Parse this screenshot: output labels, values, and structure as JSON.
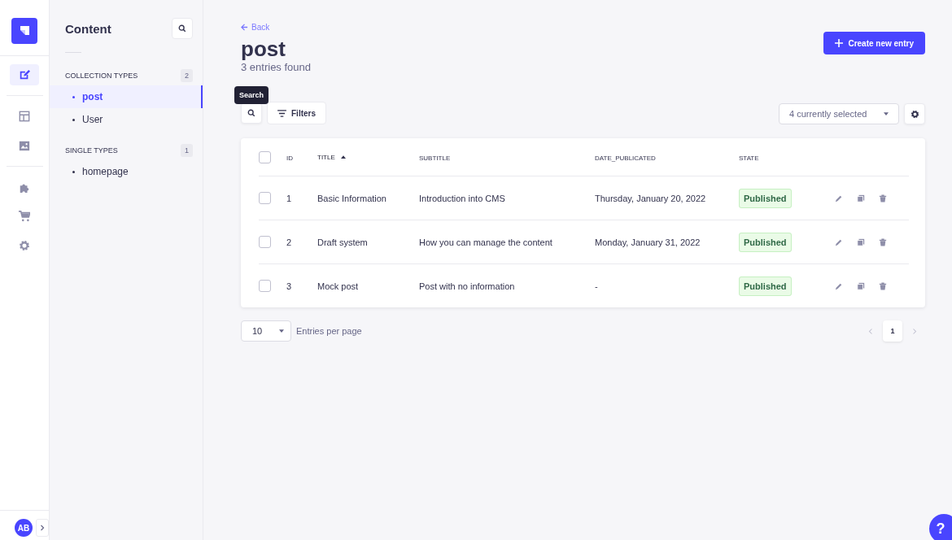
{
  "nav": {
    "items": [
      {
        "selected": true
      },
      {
        "selected": false
      },
      {
        "selected": false
      },
      {
        "selected": false
      },
      {
        "selected": false
      },
      {
        "selected": false
      }
    ],
    "avatar": "AB"
  },
  "sidebar": {
    "title": "Content",
    "sections": [
      {
        "heading": "COLLECTION TYPES",
        "count": "2",
        "items": [
          {
            "label": "post",
            "selected": true
          },
          {
            "label": "User",
            "selected": false
          }
        ]
      },
      {
        "heading": "SINGLE TYPES",
        "count": "1",
        "items": [
          {
            "label": "homepage",
            "selected": false
          }
        ]
      }
    ]
  },
  "header": {
    "back": "Back",
    "title": "post",
    "subtitle": "3 entries found",
    "create_button": "Create new entry"
  },
  "toolbar": {
    "tooltip": "Search",
    "filters": "Filters",
    "columns_select": "4 currently selected"
  },
  "table": {
    "all_checked": false,
    "columns": [
      {
        "label": "ID",
        "sorted": false
      },
      {
        "label": "TITLE",
        "sorted": true
      },
      {
        "label": "SUBTITLE",
        "sorted": false
      },
      {
        "label": "DATE_PUBLICATED",
        "sorted": false
      },
      {
        "label": "STATE",
        "sorted": false
      }
    ],
    "rows": [
      {
        "checked": false,
        "cells": [
          "1",
          "Basic Information",
          "Introduction into CMS",
          "Thursday, January 20, 2022"
        ],
        "state": "Published"
      },
      {
        "checked": false,
        "cells": [
          "2",
          "Draft system",
          "How you can manage the content",
          "Monday, January 31, 2022"
        ],
        "state": "Published"
      },
      {
        "checked": false,
        "cells": [
          "3",
          "Mock post",
          "Post with no information",
          "-"
        ],
        "state": "Published"
      }
    ]
  },
  "pagination": {
    "page_size": "10",
    "page_size_label": "Entries per page",
    "pages": [
      {
        "label": "1",
        "selected": true
      }
    ]
  },
  "help_button": "?"
}
